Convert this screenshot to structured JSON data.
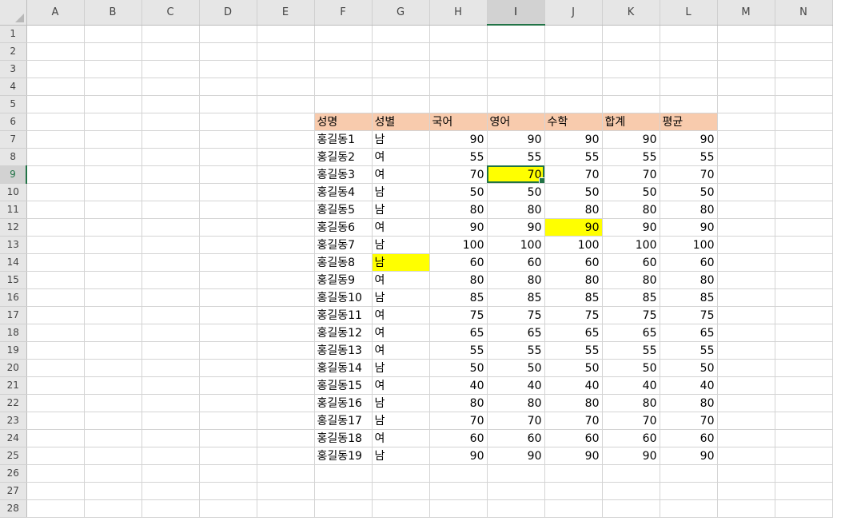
{
  "columns": [
    "A",
    "B",
    "C",
    "D",
    "E",
    "F",
    "G",
    "H",
    "I",
    "J",
    "K",
    "L",
    "M",
    "N"
  ],
  "rows": [
    "1",
    "2",
    "3",
    "4",
    "5",
    "6",
    "7",
    "8",
    "9",
    "10",
    "11",
    "12",
    "13",
    "14",
    "15",
    "16",
    "17",
    "18",
    "19",
    "20",
    "21",
    "22",
    "23",
    "24",
    "25",
    "26",
    "27",
    "28"
  ],
  "selected_column": "I",
  "selected_row": "9",
  "table": {
    "headers": [
      "성명",
      "성별",
      "국어",
      "영어",
      "수학",
      "합계",
      "평균"
    ],
    "records": [
      [
        "홍길동1",
        "남",
        "90",
        "90",
        "90",
        "90",
        "90"
      ],
      [
        "홍길동2",
        "여",
        "55",
        "55",
        "55",
        "55",
        "55"
      ],
      [
        "홍길동3",
        "여",
        "70",
        "70",
        "70",
        "70",
        "70"
      ],
      [
        "홍길동4",
        "남",
        "50",
        "50",
        "50",
        "50",
        "50"
      ],
      [
        "홍길동5",
        "남",
        "80",
        "80",
        "80",
        "80",
        "80"
      ],
      [
        "홍길동6",
        "여",
        "90",
        "90",
        "90",
        "90",
        "90"
      ],
      [
        "홍길동7",
        "남",
        "100",
        "100",
        "100",
        "100",
        "100"
      ],
      [
        "홍길동8",
        "남",
        "60",
        "60",
        "60",
        "60",
        "60"
      ],
      [
        "홍길동9",
        "여",
        "80",
        "80",
        "80",
        "80",
        "80"
      ],
      [
        "홍길동10",
        "남",
        "85",
        "85",
        "85",
        "85",
        "85"
      ],
      [
        "홍길동11",
        "여",
        "75",
        "75",
        "75",
        "75",
        "75"
      ],
      [
        "홍길동12",
        "여",
        "65",
        "65",
        "65",
        "65",
        "65"
      ],
      [
        "홍길동13",
        "여",
        "55",
        "55",
        "55",
        "55",
        "55"
      ],
      [
        "홍길동14",
        "남",
        "50",
        "50",
        "50",
        "50",
        "50"
      ],
      [
        "홍길동15",
        "여",
        "40",
        "40",
        "40",
        "40",
        "40"
      ],
      [
        "홍길동16",
        "남",
        "80",
        "80",
        "80",
        "80",
        "80"
      ],
      [
        "홍길동17",
        "남",
        "70",
        "70",
        "70",
        "70",
        "70"
      ],
      [
        "홍길동18",
        "여",
        "60",
        "60",
        "60",
        "60",
        "60"
      ],
      [
        "홍길동19",
        "남",
        "90",
        "90",
        "90",
        "90",
        "90"
      ]
    ]
  },
  "colors": {
    "header_fill": "#f8cbad",
    "highlight_fill": "#ffff00",
    "selection_accent": "#217346"
  }
}
